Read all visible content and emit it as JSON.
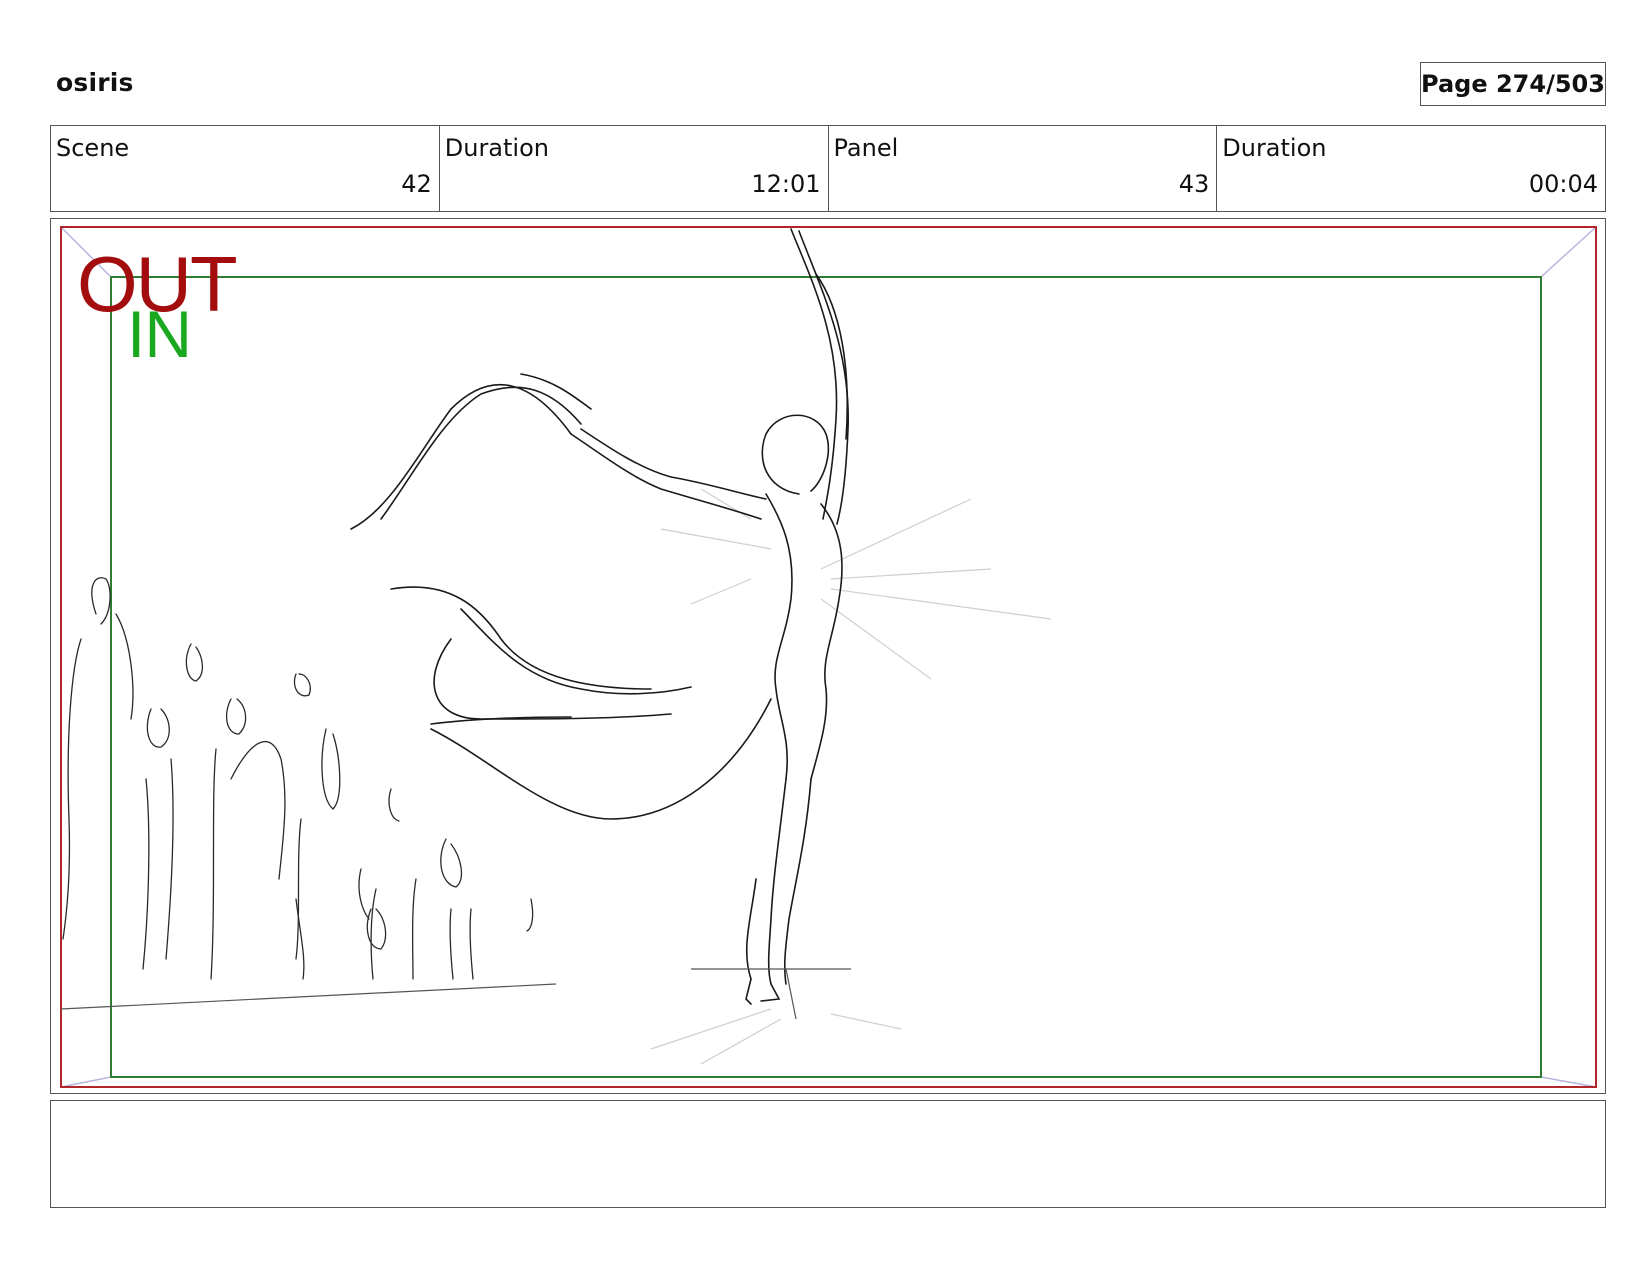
{
  "header": {
    "project_title": "osiris",
    "page_label": "Page 274/503"
  },
  "info": {
    "scene": {
      "label": "Scene",
      "value": "42"
    },
    "scene_duration": {
      "label": "Duration",
      "value": "12:01"
    },
    "panel": {
      "label": "Panel",
      "value": "43"
    },
    "panel_duration": {
      "label": "Duration",
      "value": "00:04"
    }
  },
  "panel": {
    "out_label": "OUT",
    "in_label": "IN",
    "colors": {
      "out_frame": "#b0262b",
      "in_frame": "#2e7d32",
      "out_text": "#a30d0d",
      "in_text": "#19a81f",
      "corner_guides": "#b9b3e0",
      "sketch_ink": "#1a1a1a"
    }
  },
  "notes": {
    "text": ""
  }
}
